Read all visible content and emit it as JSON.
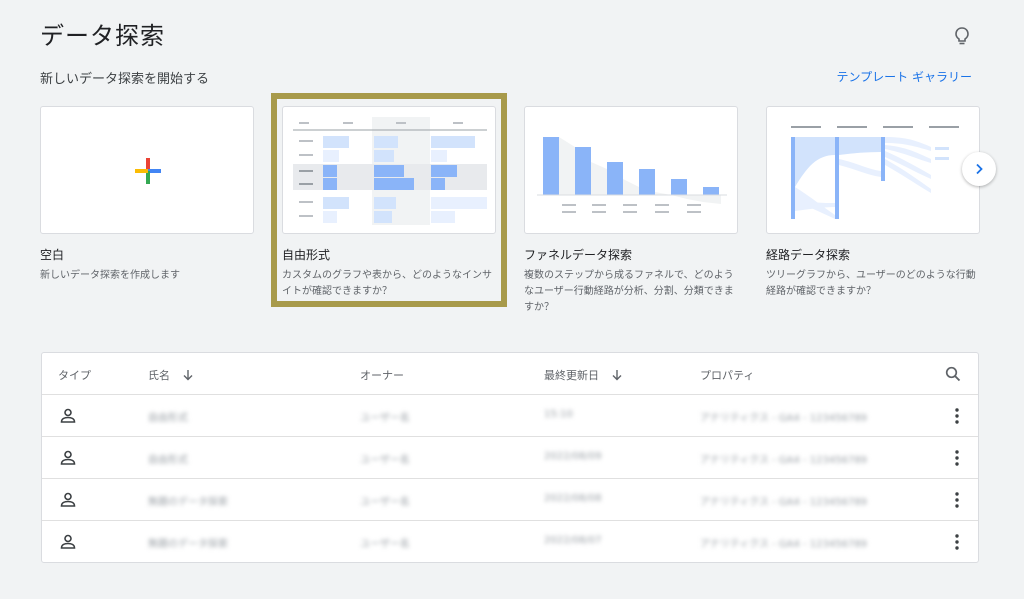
{
  "header": {
    "title": "データ探索",
    "section_label": "新しいデータ探索を開始する",
    "gallery_link": "テンプレート ギャラリー"
  },
  "cards": [
    {
      "title": "空白",
      "desc": "新しいデータ探索を作成します"
    },
    {
      "title": "自由形式",
      "desc": "カスタムのグラフや表から、どのようなインサイトが確認できますか？"
    },
    {
      "title": "ファネルデータ探索",
      "desc": "複数のステップから成るファネルで、どのようなユーザー行動経路が分析、分割、分類できますか？"
    },
    {
      "title": "経路データ探索",
      "desc": "ツリーグラフから、ユーザーのどのような行動経路が確認できますか？"
    }
  ],
  "table": {
    "headers": {
      "type": "タイプ",
      "name": "氏名",
      "owner": "オーナー",
      "modified": "最終更新日",
      "property": "プロパティ"
    },
    "rows": [
      {
        "name": "自由形式",
        "owner": "ユーザー名",
        "modified": "15:10",
        "property": "アナリティクス - GA4 - 123456789"
      },
      {
        "name": "自由形式",
        "owner": "ユーザー名",
        "modified": "2022/08/09",
        "property": "アナリティクス - GA4 - 123456789"
      },
      {
        "name": "無題のデータ探索",
        "owner": "ユーザー名",
        "modified": "2022/08/08",
        "property": "アナリティクス - GA4 - 123456789"
      },
      {
        "name": "無題のデータ探索",
        "owner": "ユーザー名",
        "modified": "2022/08/07",
        "property": "アナリティクス - GA4 - 123456789"
      }
    ]
  },
  "icons": {
    "bulb": "lightbulb-icon",
    "plus": "plus-icon",
    "next": "chevron-right-icon",
    "search": "search-icon",
    "sort": "arrow-down-icon",
    "person": "person-icon",
    "more": "more-vert-icon"
  },
  "colors": {
    "accent": "#1a73e8",
    "highlight": "#a89a4a",
    "bar": "#8ab4f8",
    "bar_light": "#d2e3fc"
  }
}
